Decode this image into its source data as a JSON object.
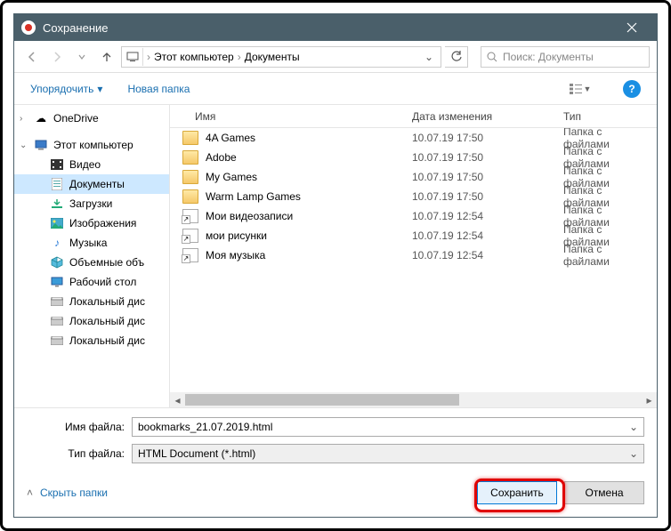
{
  "window": {
    "title": "Сохранение"
  },
  "breadcrumb": {
    "root": "Этот компьютер",
    "folder": "Документы"
  },
  "search": {
    "placeholder": "Поиск: Документы"
  },
  "toolbar": {
    "organize": "Упорядочить",
    "newfolder": "Новая папка"
  },
  "tree": {
    "onedrive": "OneDrive",
    "thispc": "Этот компьютер",
    "videos": "Видео",
    "documents": "Документы",
    "downloads": "Загрузки",
    "pictures": "Изображения",
    "music": "Музыка",
    "objects3d": "Объемные объ",
    "desktop": "Рабочий стол",
    "disk1": "Локальный дис",
    "disk2": "Локальный дис",
    "disk3": "Локальный дис"
  },
  "columns": {
    "name": "Имя",
    "date": "Дата изменения",
    "type": "Тип"
  },
  "files": [
    {
      "name": "4A Games",
      "date": "10.07.19 17:50",
      "type": "Папка с файлами",
      "kind": "folder"
    },
    {
      "name": "Adobe",
      "date": "10.07.19 17:50",
      "type": "Папка с файлами",
      "kind": "folder"
    },
    {
      "name": "My Games",
      "date": "10.07.19 17:50",
      "type": "Папка с файлами",
      "kind": "folder"
    },
    {
      "name": "Warm Lamp Games",
      "date": "10.07.19 17:50",
      "type": "Папка с файлами",
      "kind": "folder"
    },
    {
      "name": "Мои видеозаписи",
      "date": "10.07.19 12:54",
      "type": "Папка с файлами",
      "kind": "shortcut"
    },
    {
      "name": "мои рисунки",
      "date": "10.07.19 12:54",
      "type": "Папка с файлами",
      "kind": "shortcut"
    },
    {
      "name": "Моя музыка",
      "date": "10.07.19 12:54",
      "type": "Папка с файлами",
      "kind": "shortcut"
    }
  ],
  "form": {
    "filename_label": "Имя файла:",
    "filename_value": "bookmarks_21.07.2019.html",
    "filetype_label": "Тип файла:",
    "filetype_value": "HTML Document (*.html)"
  },
  "footer": {
    "hide_folders": "Скрыть папки",
    "save": "Сохранить",
    "cancel": "Отмена"
  }
}
